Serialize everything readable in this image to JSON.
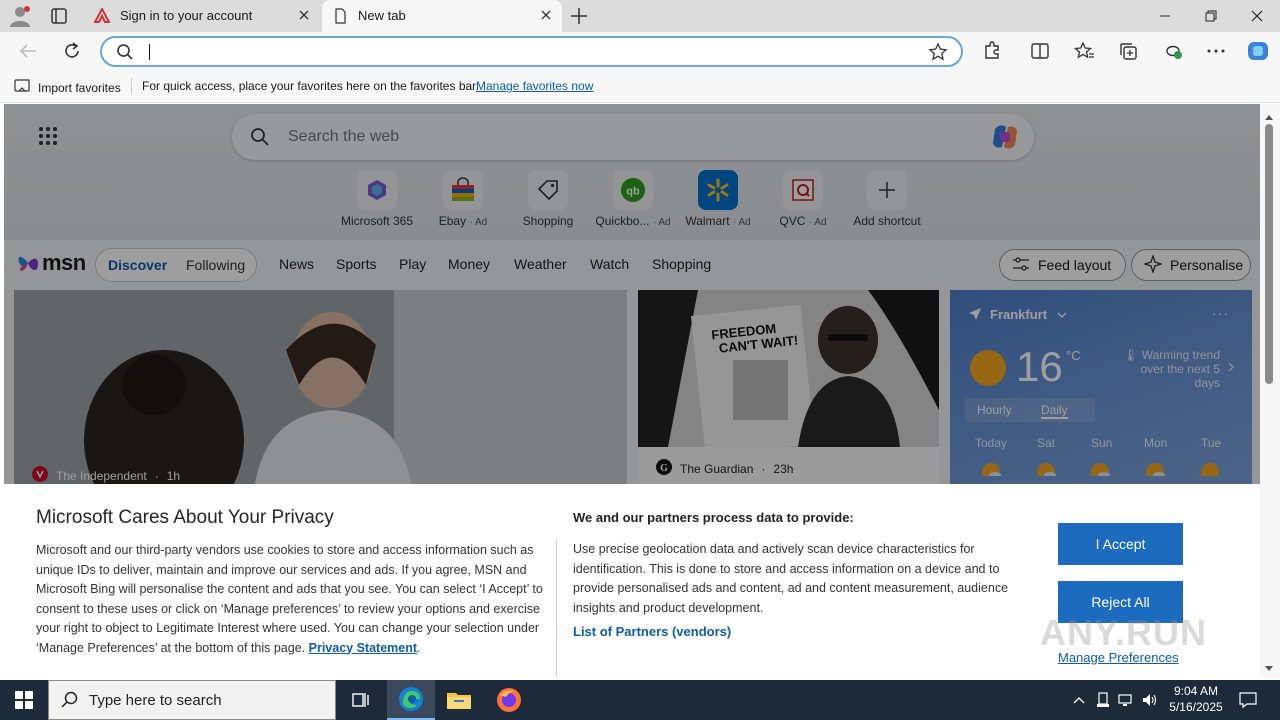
{
  "tabs": [
    {
      "title": "Sign in to your account",
      "icon": "adobe-icon",
      "active": false
    },
    {
      "title": "New tab",
      "icon": "page-icon",
      "active": true
    }
  ],
  "address_bar": {
    "value": "",
    "placeholder": ""
  },
  "favorites_bar": {
    "import_label": "Import favorites",
    "message": "For quick access, place your favorites here on the favorites bar.",
    "link": "Manage favorites now"
  },
  "newtab": {
    "search_placeholder": "Search the web",
    "shortcuts": [
      {
        "label": "Microsoft 365",
        "ad": ""
      },
      {
        "label": "Ebay",
        "ad": "· Ad"
      },
      {
        "label": "Shopping",
        "ad": ""
      },
      {
        "label": "Quickbo...",
        "ad": "· Ad"
      },
      {
        "label": "Walmart",
        "ad": "· Ad"
      },
      {
        "label": "QVC",
        "ad": "· Ad"
      },
      {
        "label": "Add shortcut",
        "ad": ""
      }
    ]
  },
  "msn": {
    "logo": "msn",
    "tabs": [
      "Discover",
      "Following"
    ],
    "nav": [
      "News",
      "Sports",
      "Play",
      "Money",
      "Weather",
      "Watch",
      "Shopping"
    ],
    "feed_layout": "Feed layout",
    "personalise": "Personalise"
  },
  "cards": [
    {
      "source": "The Independent",
      "age": "1h"
    },
    {
      "source": "The Guardian",
      "age": "23h"
    }
  ],
  "newspaper_headline": [
    "FREEDOM",
    "CAN'T WAIT!"
  ],
  "weather": {
    "location": "Frankfurt",
    "temp": "16",
    "unit": "°C",
    "trend": "Warming trend",
    "trend2": "over the next 5 days",
    "modes": [
      "Hourly",
      "Daily"
    ],
    "days": [
      "Today",
      "Sat",
      "Sun",
      "Mon",
      "Tue"
    ]
  },
  "privacy": {
    "title": "Microsoft Cares About Your Privacy",
    "body": "Microsoft and our third-party vendors use cookies to store and access information such as unique IDs to deliver, maintain and improve our services and ads. If you agree, MSN and Microsoft Bing will personalise the content and ads that you see. You can select ‘I Accept’ to consent to these uses or click on ‘Manage preferences’ to review your options and exercise your right to object to Legitimate Interest where used.  You can change your selection under ‘Manage Preferences’ at the bottom of this page.",
    "privacy_link": "Privacy Statement",
    "heading2": "We and our partners process data to provide:",
    "body2": "Use precise geolocation data and actively scan device characteristics for identification. This is done to store and access information on a device and to provide personalised ads and content, ad and content measurement, audience insights and product development.",
    "partners_link": "List of Partners (vendors)",
    "accept": "I Accept",
    "reject": "Reject All",
    "manage": "Manage Preferences"
  },
  "watermark": "ANY.RUN",
  "taskbar": {
    "search_text": "Type here to search",
    "time": "9:04 AM",
    "date": "5/16/2025"
  },
  "colors": {
    "accent": "#1d6bbf",
    "taskbar": "#1c2a3a",
    "link": "#0b5cad"
  }
}
